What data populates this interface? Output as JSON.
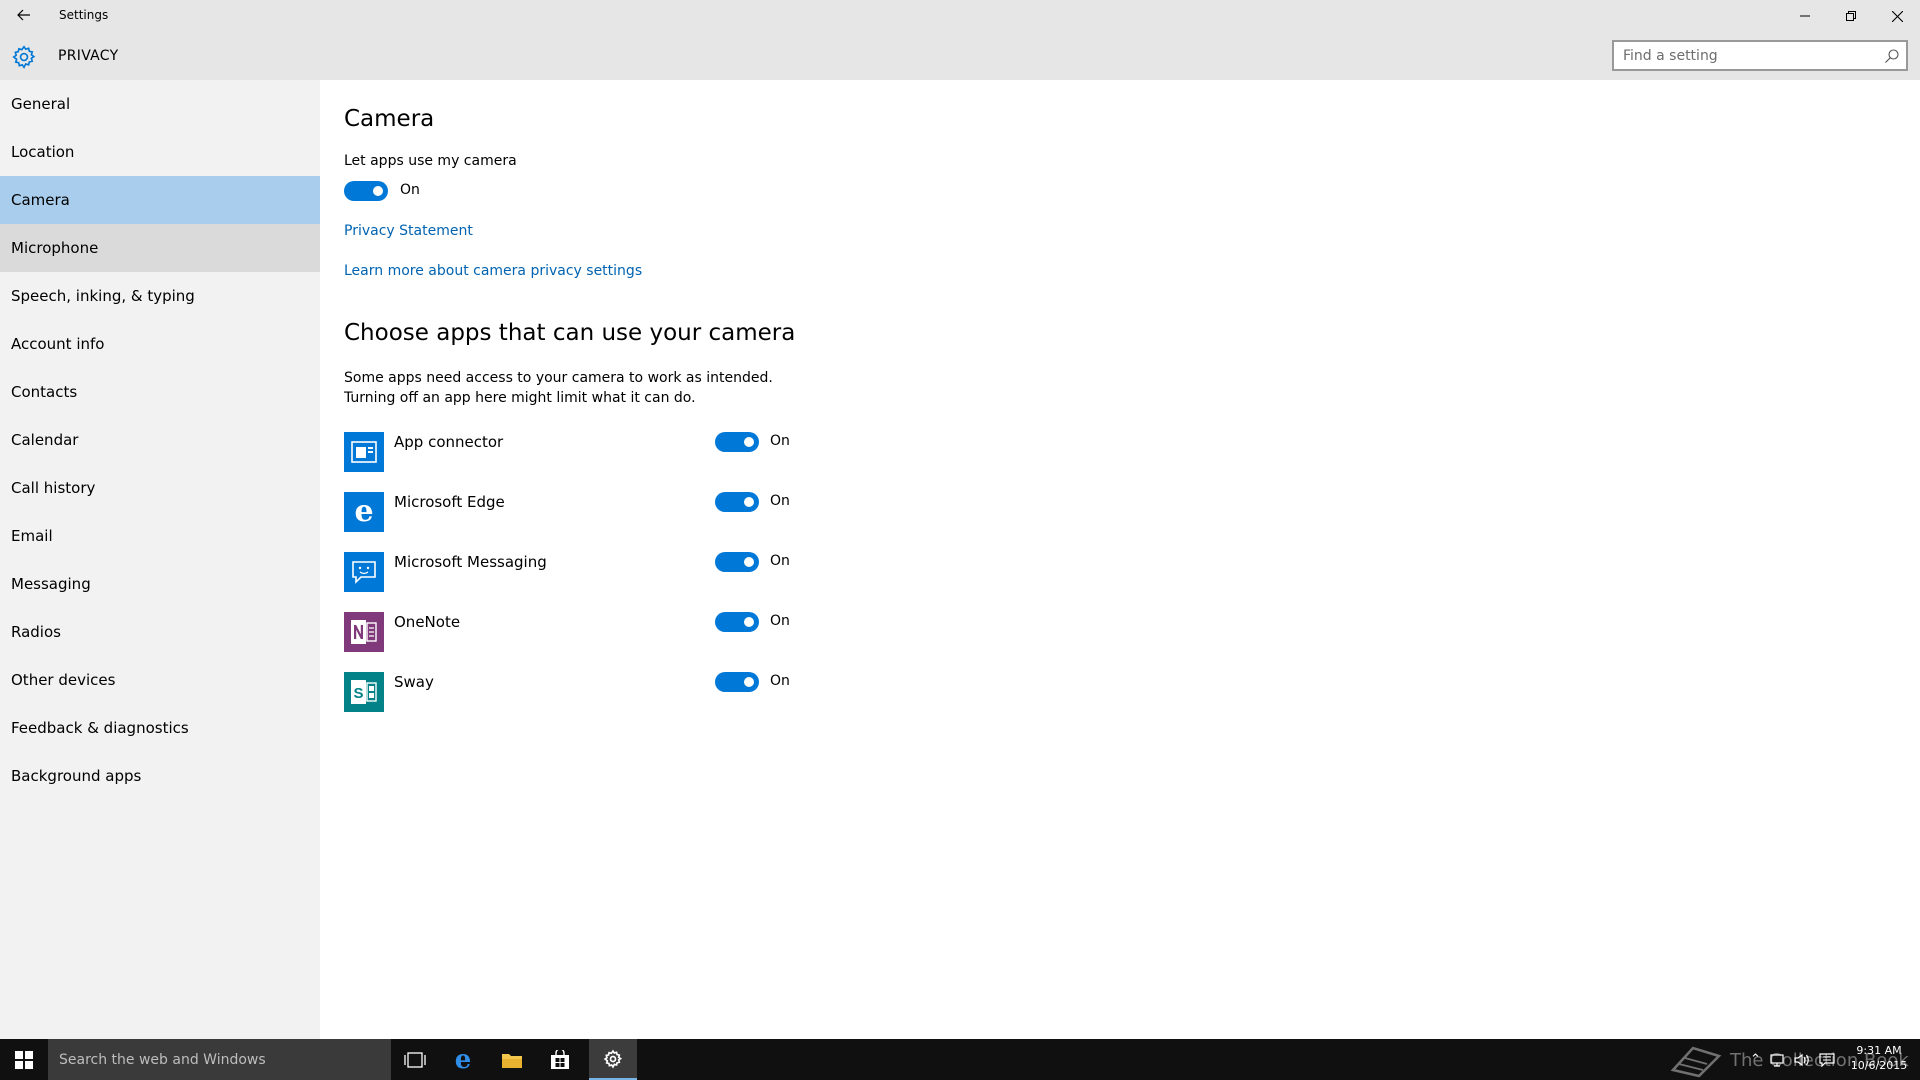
{
  "window": {
    "app_title": "Settings",
    "section_title": "PRIVACY",
    "search": {
      "placeholder": "Find a setting",
      "value": ""
    }
  },
  "sidebar": {
    "selected": "Camera",
    "hovered": "Microphone",
    "items": [
      {
        "label": "General"
      },
      {
        "label": "Location"
      },
      {
        "label": "Camera"
      },
      {
        "label": "Microphone"
      },
      {
        "label": "Speech, inking, & typing"
      },
      {
        "label": "Account info"
      },
      {
        "label": "Contacts"
      },
      {
        "label": "Calendar"
      },
      {
        "label": "Call history"
      },
      {
        "label": "Email"
      },
      {
        "label": "Messaging"
      },
      {
        "label": "Radios"
      },
      {
        "label": "Other devices"
      },
      {
        "label": "Feedback & diagnostics"
      },
      {
        "label": "Background apps"
      }
    ]
  },
  "main": {
    "heading": "Camera",
    "master_toggle": {
      "label": "Let apps use my camera",
      "state": "On",
      "on": true
    },
    "privacy_statement_link": "Privacy Statement",
    "learn_more_link": "Learn more about camera privacy settings",
    "apps_heading": "Choose apps that can use your camera",
    "apps_description": [
      "Some apps need access to your camera to work as intended.",
      "Turning off an app here might limit what it can do."
    ],
    "apps": [
      {
        "name": "App connector",
        "icon": "app-connector-icon",
        "icon_color": "#0078d7",
        "state": "On",
        "on": true
      },
      {
        "name": "Microsoft Edge",
        "icon": "edge-icon",
        "icon_color": "#0078d7",
        "state": "On",
        "on": true
      },
      {
        "name": "Microsoft Messaging",
        "icon": "messaging-icon",
        "icon_color": "#0078d7",
        "state": "On",
        "on": true
      },
      {
        "name": "OneNote",
        "icon": "onenote-icon",
        "icon_color": "#80397b",
        "state": "On",
        "on": true
      },
      {
        "name": "Sway",
        "icon": "sway-icon",
        "icon_color": "#038387",
        "state": "On",
        "on": true
      }
    ]
  },
  "taskbar": {
    "search_placeholder": "Search the web and Windows",
    "pinned": [
      "task-view-icon",
      "edge-icon",
      "file-explorer-icon",
      "store-icon",
      "settings-icon"
    ],
    "watermark": "The Collection Book",
    "clock": {
      "time": "9:31 AM",
      "date": "10/6/2015"
    }
  },
  "colors": {
    "accent": "#0078d7",
    "link": "#0063b1",
    "sidebar_selected": "#a9cdec",
    "sidebar_bg": "#f2f2f2",
    "header_bg": "#e6e6e6",
    "taskbar_bg": "#101010"
  }
}
